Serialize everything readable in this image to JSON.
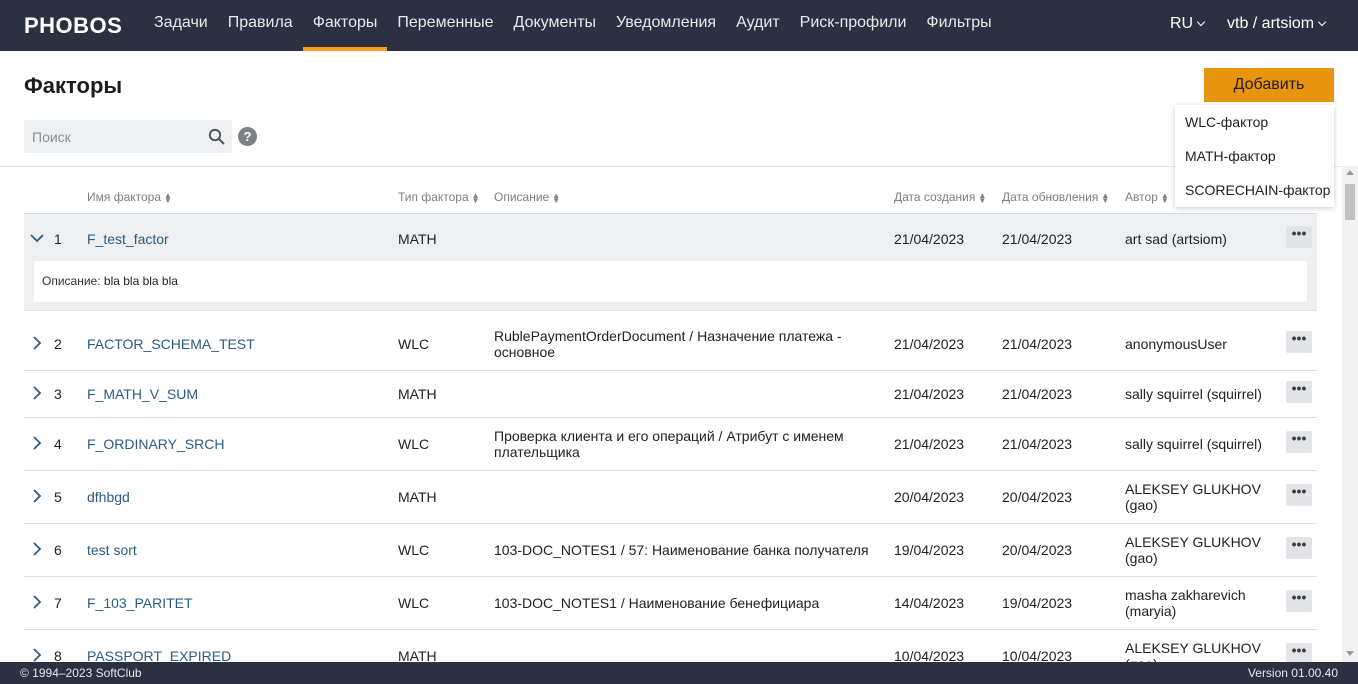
{
  "app": {
    "logo": "PHOBOS"
  },
  "nav": {
    "items": [
      "Задачи",
      "Правила",
      "Факторы",
      "Переменные",
      "Документы",
      "Уведомления",
      "Аудит",
      "Риск-профили",
      "Фильтры"
    ],
    "active": "Факторы",
    "language": "RU",
    "user": "vtb / artsiom"
  },
  "page": {
    "title": "Факторы",
    "add_button": "Добавить",
    "search_placeholder": "Поиск",
    "help": "?"
  },
  "add_menu": [
    "WLC-фактор",
    "MATH-фактор",
    "SCORECHAIN-фактор"
  ],
  "table": {
    "columns": [
      "Имя фактора",
      "Тип фактора",
      "Описание",
      "Дата создания",
      "Дата обновления",
      "Автор"
    ],
    "rows": [
      {
        "num": "1",
        "name": "F_test_factor",
        "type": "MATH",
        "description": "",
        "created": "21/04/2023",
        "updated": "21/04/2023",
        "author": "art sad (artsiom)",
        "expanded": true,
        "detail_label": "Описание:",
        "detail_value": "bla bla bla bla"
      },
      {
        "num": "2",
        "name": "FACTOR_SCHEMA_TEST",
        "type": "WLC",
        "description": "RublePaymentOrderDocument / Назначение платежа - основное",
        "created": "21/04/2023",
        "updated": "21/04/2023",
        "author": "anonymousUser"
      },
      {
        "num": "3",
        "name": "F_MATH_V_SUM",
        "type": "MATH",
        "description": "",
        "created": "21/04/2023",
        "updated": "21/04/2023",
        "author": "sally squirrel (squirrel)"
      },
      {
        "num": "4",
        "name": "F_ORDINARY_SRCH",
        "type": "WLC",
        "description": "Проверка клиента и его операций / Атрибут с именем плательщика",
        "created": "21/04/2023",
        "updated": "21/04/2023",
        "author": "sally squirrel (squirrel)"
      },
      {
        "num": "5",
        "name": "dfhbgd",
        "type": "MATH",
        "description": "",
        "created": "20/04/2023",
        "updated": "20/04/2023",
        "author": "ALEKSEY GLUKHOV (gao)"
      },
      {
        "num": "6",
        "name": "test sort",
        "type": "WLC",
        "description": "103-DOC_NOTES1 / 57: Наименование банка получателя",
        "created": "19/04/2023",
        "updated": "20/04/2023",
        "author": "ALEKSEY GLUKHOV (gao)"
      },
      {
        "num": "7",
        "name": "F_103_PARITET",
        "type": "WLC",
        "description": "103-DOC_NOTES1 / Наименование бенефициара",
        "created": "14/04/2023",
        "updated": "19/04/2023",
        "author": "masha zakharevich (maryia)"
      },
      {
        "num": "8",
        "name": "PASSPORT_EXPIRED",
        "type": "MATH",
        "description": "",
        "created": "10/04/2023",
        "updated": "10/04/2023",
        "author": "ALEKSEY GLUKHOV (gao)"
      }
    ],
    "more_label": "•••"
  },
  "footer": {
    "copyright": "© 1994–2023 SoftClub",
    "version": "Version 01.00.40"
  },
  "colors": {
    "topbar": "#2b3140",
    "accent": "#f0a01c",
    "button": "#e8940f",
    "link": "#2c5b85"
  }
}
